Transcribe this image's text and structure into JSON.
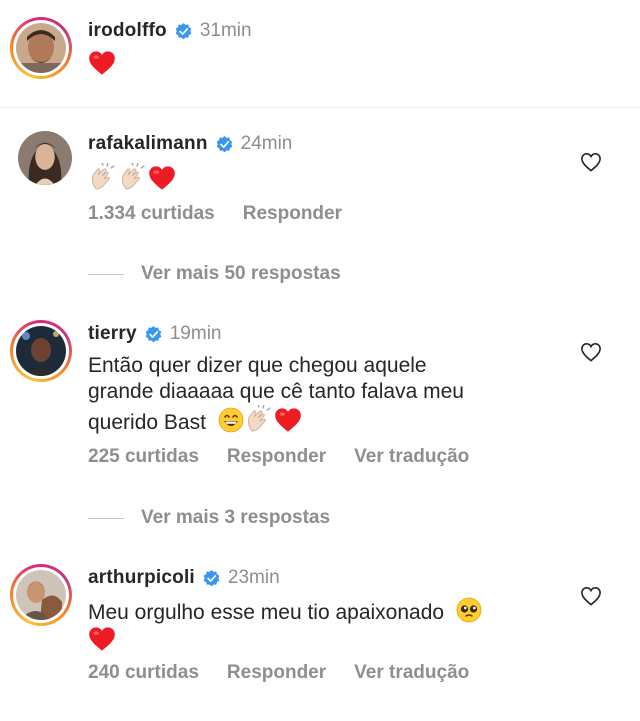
{
  "colors": {
    "text": "#262626",
    "secondary": "#8e8e8e",
    "verified": "#3897f0",
    "heart": "#ed1c24"
  },
  "caption": {
    "username": "irodolffo",
    "time": "31min",
    "text": "",
    "emojis": [
      "red-heart"
    ]
  },
  "comments": [
    {
      "username": "rafakalimann",
      "time": "24min",
      "text": "",
      "emojis": [
        "clapping-hands",
        "clapping-hands",
        "red-heart"
      ],
      "likes": "1.334 curtidas",
      "reply_label": "Responder",
      "view_replies": "Ver mais 50 respostas"
    },
    {
      "username": "tierry",
      "time": "19min",
      "text_line1": "Então quer dizer que chegou aquele",
      "text_line2": "grande diaaaaa que cê tanto falava meu",
      "text_line3": "querido Bast",
      "emojis": [
        "grinning-face",
        "clapping-hands",
        "red-heart"
      ],
      "likes": "225 curtidas",
      "reply_label": "Responder",
      "translate_label": "Ver tradução",
      "view_replies": "Ver mais 3 respostas"
    },
    {
      "username": "arthurpicoli",
      "time": "23min",
      "text_line1": "Meu orgulho esse meu tio apaixonado",
      "emojis": [
        "pleading-face",
        "red-heart"
      ],
      "likes": "240 curtidas",
      "reply_label": "Responder",
      "translate_label": "Ver tradução"
    }
  ]
}
